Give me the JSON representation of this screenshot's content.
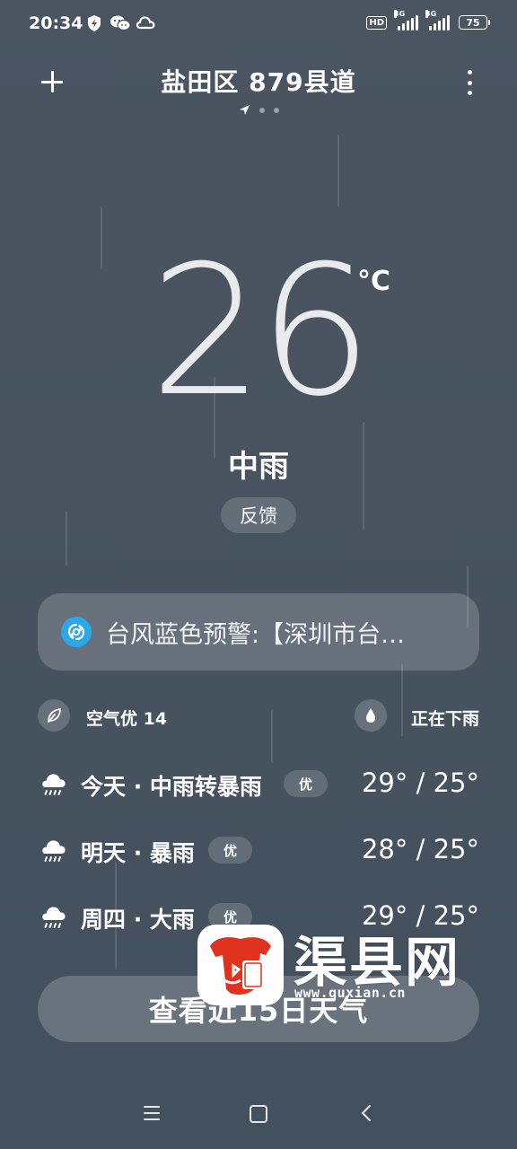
{
  "status_bar": {
    "time": "20:34",
    "icons": [
      "shield-bolt-icon",
      "wechat-icon",
      "cloud-icon"
    ],
    "hd": "HD",
    "network_type": "4G",
    "battery": "75"
  },
  "header": {
    "title": "盐田区 879县道",
    "icons": {
      "add": "plus-icon",
      "more": "more-vertical-icon",
      "location": "location-arrow-icon"
    }
  },
  "current": {
    "temperature": "26",
    "unit": "°C",
    "condition": "中雨",
    "feedback_label": "反馈"
  },
  "alert": {
    "text": "台风蓝色预警:【深圳市台…",
    "icon": "typhoon-icon",
    "icon_color": "#2aa8ea"
  },
  "info": {
    "air_quality": "空气优 14",
    "air_icon": "leaf-icon",
    "precip_status": "正在下雨",
    "precip_icon": "water-drop-icon"
  },
  "forecast": [
    {
      "label": "今天 · 中雨转暴雨",
      "badge": "优",
      "temps": "29° / 25°",
      "icon": "rain-cloud-icon"
    },
    {
      "label": "明天 · 暴雨",
      "badge": "优",
      "temps": "28° / 25°",
      "icon": "rain-cloud-icon"
    },
    {
      "label": "周四 · 大雨",
      "badge": "优",
      "temps": "29° / 25°",
      "icon": "rain-cloud-icon"
    }
  ],
  "more_button": "查看近15日天气",
  "watermark": {
    "name": "渠县网",
    "url": "www.quxian.cn",
    "logo_color": "#e0321e"
  }
}
